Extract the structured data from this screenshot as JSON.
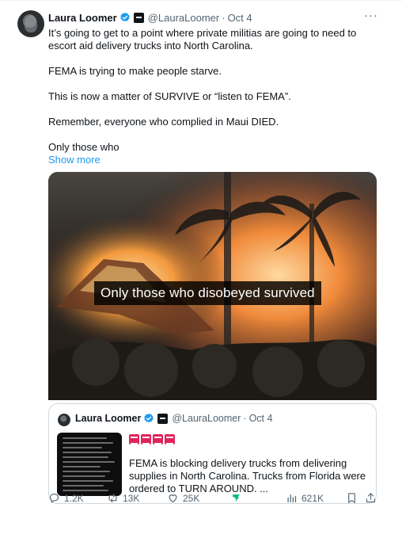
{
  "tweet": {
    "author_name": "Laura Loomer",
    "handle": "@LauraLoomer",
    "separator": "·",
    "date": "Oct 4",
    "more_label": "···",
    "paragraphs": [
      "It’s going to get to a point where private militias are going to need to escort aid delivery trucks into North Carolina.",
      "FEMA is trying to make people starve.",
      "This is now a matter of SURVIVE or “listen to FEMA”.",
      "Remember, everyone who complied in Maui DIED.",
      "Only those who"
    ],
    "show_more": "Show more",
    "media_caption": "Only those who disobeyed survived"
  },
  "quote": {
    "author_name": "Laura Loomer",
    "handle": "@LauraLoomer",
    "separator": "·",
    "date": "Oct 4",
    "emoji": [
      "alarm-emoji",
      "alarm-emoji",
      "alarm-emoji",
      "alarm-emoji"
    ],
    "text": "FEMA is blocking delivery trucks from delivering supplies in North Carolina. Trucks from Florida were ordered to TURN AROUND. ..."
  },
  "actions": {
    "replies": "1.2K",
    "reposts": "13K",
    "likes": "25K",
    "views": "621K"
  },
  "colors": {
    "link": "#1d9bf0",
    "secondary_text": "#536471",
    "verified_badge": "#1d9bf0",
    "grok_icon": "#00ba7c"
  }
}
